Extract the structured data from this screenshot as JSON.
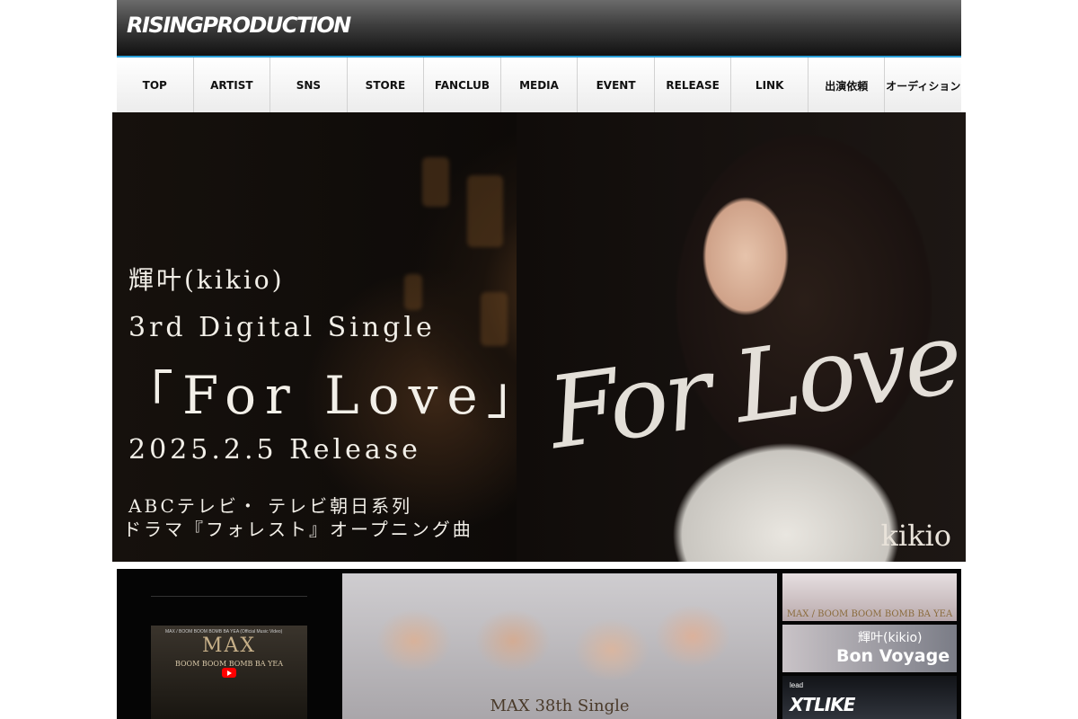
{
  "header": {
    "logo_text": "RISINGPRODUCTION"
  },
  "nav": {
    "items": [
      "TOP",
      "ARTIST",
      "SNS",
      "STORE",
      "FANCLUB",
      "MEDIA",
      "EVENT",
      "RELEASE",
      "LINK",
      "出演依頼",
      "オーディション"
    ],
    "accent": "#2a9fd8"
  },
  "banner": {
    "artist": "輝叶(kikio)",
    "single_type": "3rd Digital Single",
    "title": "「For Love」",
    "release": "2025.2.5 Release",
    "tie_in_1": "ABCテレビ・ テレビ朝日系列",
    "tie_in_2": "ドラマ『フォレスト』オープニング曲",
    "script_title": "For Love",
    "brand": "kikio"
  },
  "lower": {
    "video": {
      "title": "MAX / BOOM BOOM BOMB BA YEA (Official Music Video)",
      "logo": "MAX",
      "subtitle": "BOOM BOOM BOMB BA YEA"
    },
    "promo_caption": "MAX 38th Single",
    "thumbs": {
      "t1": "MAX / BOOM BOOM BOMB BA YEA",
      "t2_name": "輝叶(kikio)",
      "t2_title": "Bon Voyage",
      "t3_label": "lead",
      "t3_name": "XTLIKE"
    }
  }
}
